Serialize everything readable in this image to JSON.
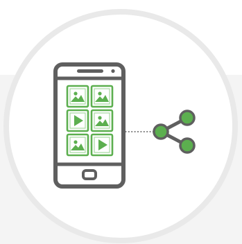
{
  "illustration": {
    "subject": "smartphone-media-sharing",
    "icons": [
      "smartphone-icon",
      "image-icon",
      "play-video-icon",
      "share-icon"
    ],
    "media_grid": [
      [
        "image",
        "image"
      ],
      [
        "play",
        "image"
      ],
      [
        "image",
        "play"
      ]
    ],
    "colors": {
      "background": "#ffffff",
      "band": "#f4f4f4",
      "circle_fill": "#ffffff",
      "circle_stroke": "#e9e9e9",
      "outline": "#5f5f5f",
      "accent": "#5caf4f",
      "accent_light": "#a7d9a0"
    }
  }
}
